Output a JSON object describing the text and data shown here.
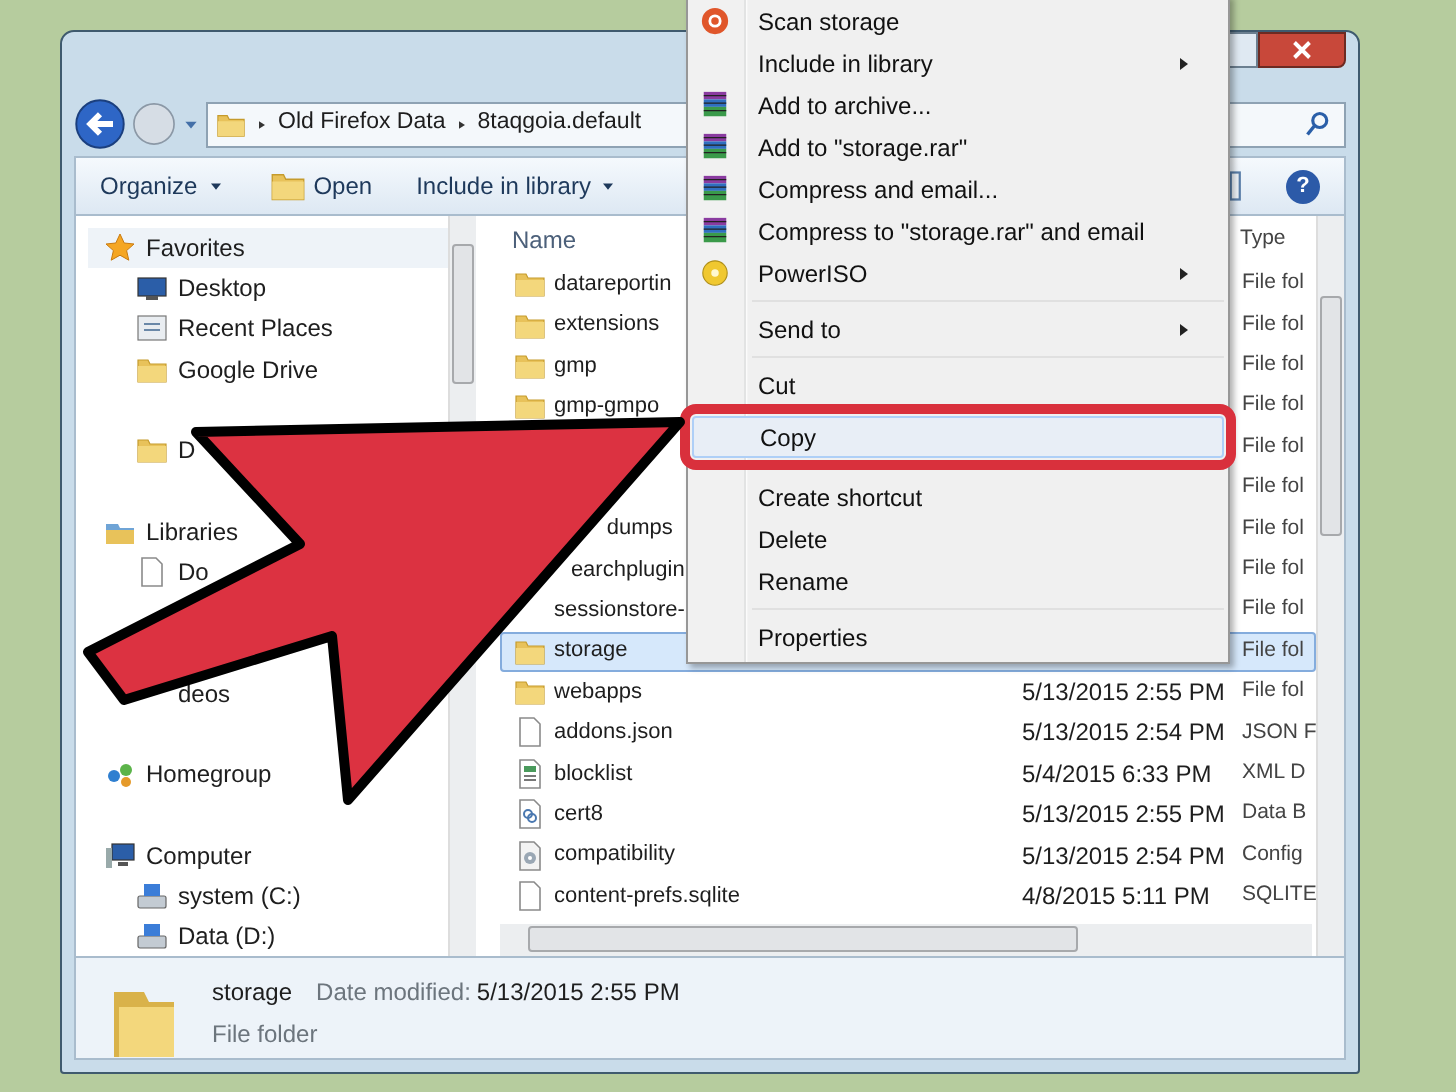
{
  "window": {
    "address": [
      "Old Firefox Data",
      "8taqgoia.default"
    ]
  },
  "toolbar": [
    {
      "label": "Organize",
      "dropdown": true
    },
    {
      "label": "Open",
      "dropdown": false
    },
    {
      "label": "Include in library",
      "dropdown": true
    }
  ],
  "help_button": "?",
  "sidebar": [
    {
      "label": "Favorites",
      "kind": "favorites",
      "items": [
        {
          "label": "Desktop",
          "kind": "desktop"
        },
        {
          "label": "Recent Places",
          "kind": "recent"
        },
        {
          "label": "Google Drive",
          "kind": "folder"
        },
        {
          "label": "D",
          "kind": "folder"
        }
      ]
    },
    {
      "label": "Libraries",
      "kind": "libraries",
      "items": [
        {
          "label": "Do",
          "kind": "file"
        },
        {
          "label": "deos",
          "kind": "covered"
        }
      ]
    },
    {
      "label": "Homegroup",
      "kind": "homegroup"
    },
    {
      "label": "Computer",
      "kind": "computer",
      "items": [
        {
          "label": "system (C:)",
          "kind": "drive"
        },
        {
          "label": "Data (D:)",
          "kind": "drive"
        }
      ]
    }
  ],
  "files": {
    "columns": [
      "Name",
      "Type"
    ],
    "rows": [
      {
        "name": "datareportin",
        "type": "File fol",
        "kind": "folder",
        "selected": false
      },
      {
        "name": "extensions",
        "type": "File fol",
        "kind": "folder",
        "selected": false
      },
      {
        "name": "gmp",
        "type": "File fol",
        "kind": "folder",
        "selected": false
      },
      {
        "name": "gmp-gmpo",
        "type": "File fol",
        "kind": "folder",
        "selected": false
      },
      {
        "type": "File fol",
        "kind": "covered",
        "selected": false
      },
      {
        "type": "File fol",
        "kind": "covered",
        "selected": false
      },
      {
        "name": "dumps",
        "type": "File fol",
        "kind": "cut",
        "selected": false
      },
      {
        "name": "earchplugin",
        "type": "File fol",
        "kind": "cut",
        "selected": false
      },
      {
        "name": "sessionstore-",
        "type": "File fol",
        "kind": "cut",
        "selected": false
      },
      {
        "name": "storage",
        "type": "File fol",
        "kind": "folder",
        "selected": true
      },
      {
        "name": "webapps",
        "date": "5/13/2015 2:55 PM",
        "type": "File fol",
        "kind": "folder",
        "selected": false
      },
      {
        "name": "addons.json",
        "date": "5/13/2015 2:54 PM",
        "type": "JSON F",
        "kind": "file",
        "selected": false
      },
      {
        "name": "blocklist",
        "date": "5/4/2015 6:33 PM",
        "type": "XML D",
        "kind": "xml",
        "selected": false
      },
      {
        "name": "cert8",
        "date": "5/13/2015 2:55 PM",
        "type": "Data B",
        "kind": "cert",
        "selected": false
      },
      {
        "name": "compatibility",
        "date": "5/13/2015 2:54 PM",
        "type": "Config",
        "kind": "config",
        "selected": false
      },
      {
        "name": "content-prefs.sqlite",
        "date": "4/8/2015 5:11 PM",
        "type": "SQLITE",
        "kind": "file",
        "selected": false
      }
    ]
  },
  "context_menu": [
    {
      "kind": "scan",
      "label": "Scan storage",
      "submenu": false,
      "highlighted": false
    },
    {
      "kind": "plain",
      "label": "Include in library",
      "submenu": true,
      "highlighted": false
    },
    {
      "kind": "rar",
      "label": "Add to archive...",
      "submenu": false,
      "highlighted": false
    },
    {
      "kind": "rar",
      "label": "Add to \"storage.rar\"",
      "submenu": false,
      "highlighted": false
    },
    {
      "kind": "rar",
      "label": "Compress and email...",
      "submenu": false,
      "highlighted": false
    },
    {
      "kind": "rar",
      "label": "Compress to \"storage.rar\" and email",
      "submenu": false,
      "highlighted": false
    },
    {
      "kind": "disc",
      "label": "PowerISO",
      "submenu": true,
      "highlighted": false
    },
    {
      "kind": "separator"
    },
    {
      "kind": "plain",
      "label": "Send to",
      "submenu": true,
      "highlighted": false
    },
    {
      "kind": "separator"
    },
    {
      "kind": "plain",
      "label": "Cut",
      "submenu": false,
      "highlighted": false
    },
    {
      "kind": "plain",
      "label": "Copy",
      "submenu": false,
      "highlighted": true
    },
    {
      "kind": "separator"
    },
    {
      "kind": "plain",
      "label": "Create shortcut",
      "submenu": false,
      "highlighted": false
    },
    {
      "kind": "plain",
      "label": "Delete",
      "submenu": false,
      "highlighted": false
    },
    {
      "kind": "plain",
      "label": "Rename",
      "submenu": false,
      "highlighted": false
    },
    {
      "kind": "separator"
    },
    {
      "kind": "plain",
      "label": "Properties",
      "submenu": false,
      "highlighted": false
    }
  ],
  "status_bar": {
    "name": "storage",
    "label": "Date modified:",
    "date": "5/13/2015 2:55 PM",
    "type": "File folder"
  }
}
